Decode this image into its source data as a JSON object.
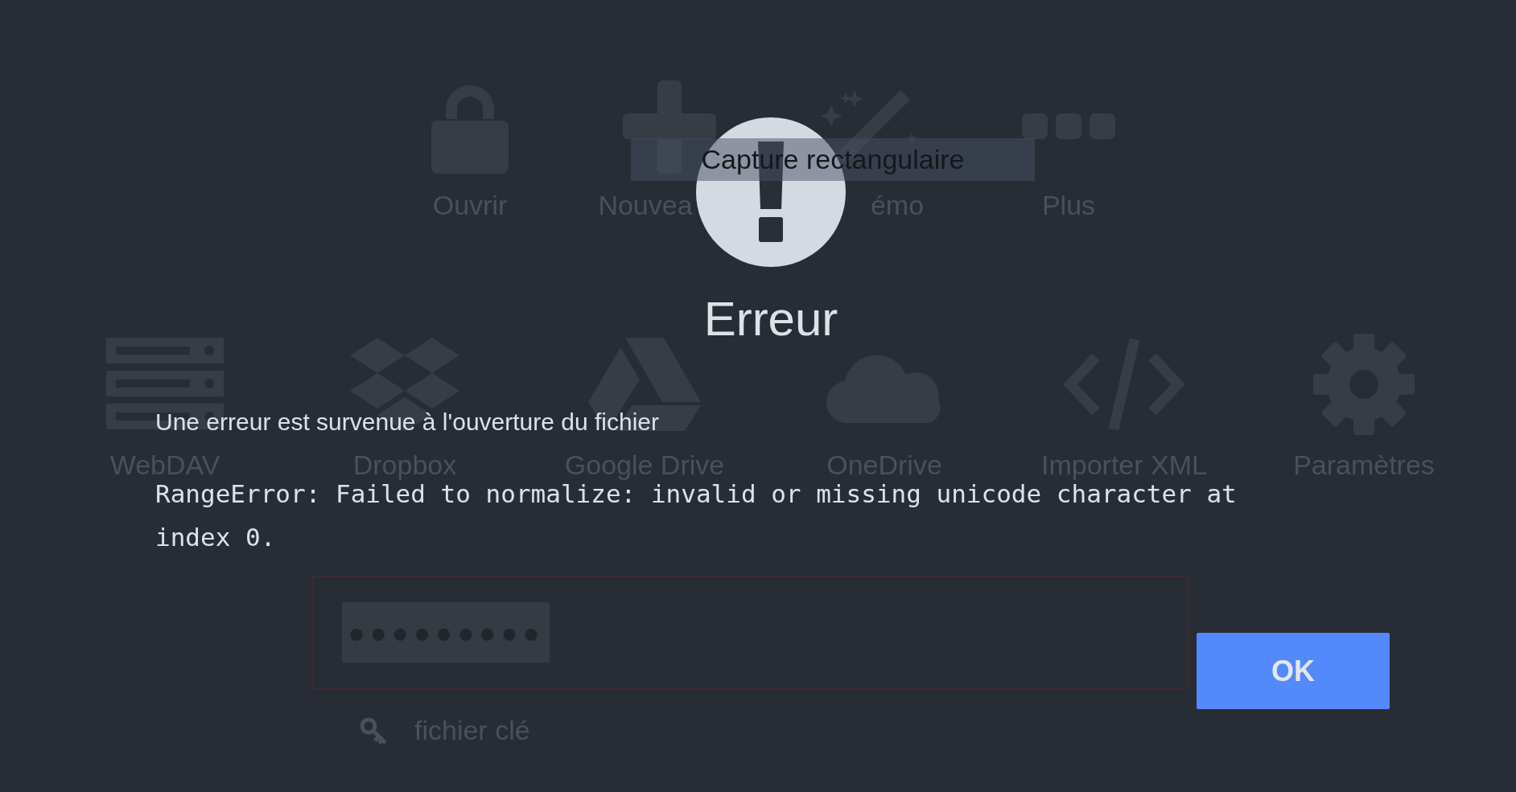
{
  "background": {
    "actions": [
      {
        "kind": "lock",
        "label": "Ouvrir"
      },
      {
        "kind": "plus",
        "label": "Nouvea"
      },
      {
        "kind": "wand",
        "label": "émo"
      },
      {
        "kind": "more",
        "label": "Plus"
      }
    ],
    "tooltip": "Capture rectangulaire",
    "storage": [
      {
        "kind": "server",
        "label": "WebDAV"
      },
      {
        "kind": "boxes",
        "label": "Dropbox"
      },
      {
        "kind": "triangle",
        "label": "Google Drive"
      },
      {
        "kind": "cloud",
        "label": "OneDrive"
      },
      {
        "kind": "code",
        "label": "Importer XML"
      },
      {
        "kind": "gear",
        "label": "Paramètres"
      }
    ],
    "password": {
      "value": "●●●●●●●●●"
    },
    "keyfile": "fichier clé"
  },
  "dialog": {
    "title": "Erreur",
    "message": "Une erreur est survenue à l'ouverture du fichier",
    "details": "RangeError: Failed to normalize: invalid or missing unicode character at index 0.",
    "buttons": [
      {
        "label": "OK"
      }
    ]
  }
}
